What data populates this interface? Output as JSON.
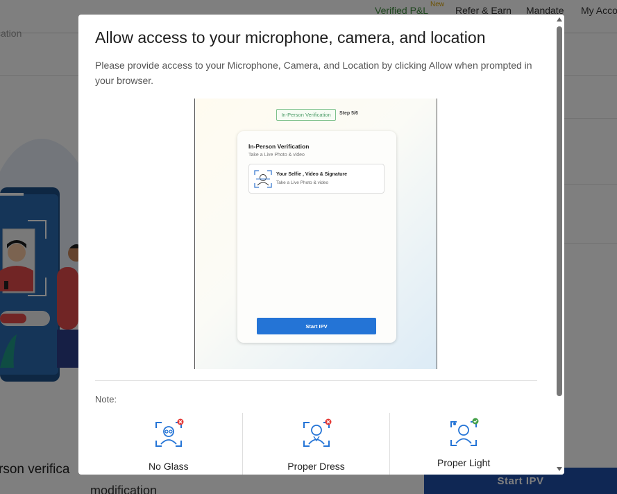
{
  "topnav": {
    "verified_pl": "Verified P&L",
    "new_badge": "New",
    "refer_earn": "Refer & Earn",
    "mandate": "Mandate",
    "my_account": "My Acco"
  },
  "background": {
    "location_text": "cation",
    "title": "rson verifica",
    "subtitle": "modification",
    "start_button": "Start IPV"
  },
  "modal": {
    "title": "Allow access to your microphone, camera, and location",
    "description": "Please provide access to your Microphone, Camera, and Location by clicking Allow when prompted in your browser.",
    "preview": {
      "badge": "In-Person Verification",
      "step": "Step 5/6",
      "card_title": "In-Person Verification",
      "card_subtitle": "Take a Live Photo & video",
      "option_title": "Your Selfie , Video & Signature",
      "option_subtitle": "Take a Live Photo & video",
      "start_button": "Start IPV"
    },
    "note_label": "Note:",
    "tips": [
      {
        "label": "No Glass",
        "status": "not-allowed",
        "icon": "face-glasses-icon"
      },
      {
        "label": "Proper Dress",
        "status": "not-allowed",
        "icon": "face-dress-icon"
      },
      {
        "label": "Proper Light",
        "status": "allowed",
        "icon": "face-light-icon"
      }
    ]
  },
  "colors": {
    "accent_blue": "#2474d6",
    "bg_button": "#1f4fa8",
    "error_red": "#e53935",
    "success_green": "#43a047",
    "verified_green": "#3a8a3a",
    "new_yellow": "#d8a000"
  }
}
